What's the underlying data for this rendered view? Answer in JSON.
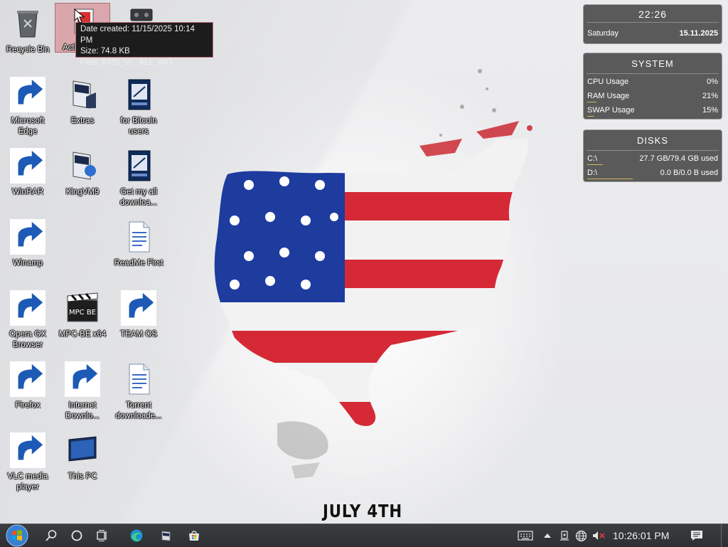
{
  "desktop": {
    "icons": [
      {
        "label": "Recycle Bin"
      },
      {
        "label": "Acti"
      },
      {
        "label": ""
      },
      {
        "label": "Microsoft Edge"
      },
      {
        "label": "Extras"
      },
      {
        "label": "for Bitcoin users"
      },
      {
        "label": "WinRAR"
      },
      {
        "label": "KingVM9"
      },
      {
        "label": "Get my all downloa..."
      },
      {
        "label": "Winamp"
      },
      {
        "label": "ReadMe First"
      },
      {
        "label": "Opera GX Browser"
      },
      {
        "label": "MPC-BE x64"
      },
      {
        "label": "TEAM OS"
      },
      {
        "label": "Firefox"
      },
      {
        "label": "Internet Downlo..."
      },
      {
        "label": "Torrent downloade..."
      },
      {
        "label": "VLC media player"
      },
      {
        "label": "This PC"
      }
    ],
    "tooltip": {
      "date_created": "Date created: 11/15/2025 10:14 PM",
      "size": "Size: 74.8 KB",
      "files": "Files: KMS_VL_ALL_AIO"
    },
    "wallpaper_caption": "JULY 4TH"
  },
  "widgets": {
    "clock": {
      "time": "22:26",
      "day": "Saturday",
      "date": "15.11.2025"
    },
    "system": {
      "title": "SYSTEM",
      "rows": [
        {
          "label": "CPU Usage",
          "value": "0%",
          "usage": 0.0
        },
        {
          "label": "RAM Usage",
          "value": "21%",
          "usage": 0.21
        },
        {
          "label": "SWAP Usage",
          "value": "15%",
          "usage": 0.15
        }
      ]
    },
    "disks": {
      "title": "DISKS",
      "rows": [
        {
          "label": "C:\\",
          "value": "27.7 GB/79.4 GB used",
          "usage": 0.35
        },
        {
          "label": "D:\\",
          "value": "0.0 B/0.0 B used",
          "usage": 1.0
        }
      ]
    }
  },
  "taskbar": {
    "items": [
      "start-orb-icon",
      "search-icon",
      "cortana-icon",
      "task-view-icon",
      "edge-icon",
      "app-icon",
      "store-icon"
    ],
    "tray": [
      "keyboard-icon",
      "chevron-up-icon",
      "network-device-icon",
      "globe-icon",
      "speaker-muted-icon"
    ],
    "clock": "10:26:01 PM",
    "notification_icon": "action-center-icon"
  },
  "colors": {
    "taskbar": "#2d2f33",
    "widget_bg": "#464646",
    "usage_bar": "#d6b85a",
    "selection": "#d6788c"
  }
}
